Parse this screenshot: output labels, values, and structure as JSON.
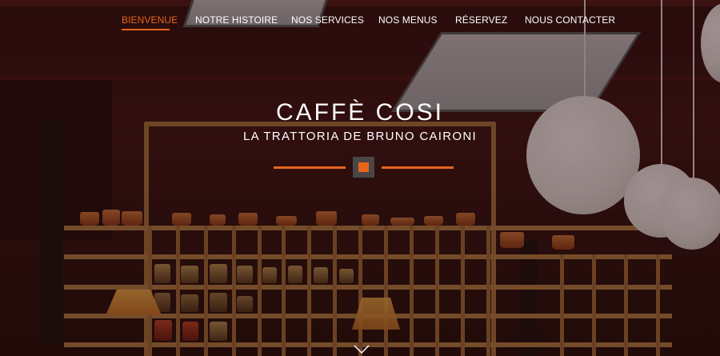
{
  "nav": {
    "items": [
      {
        "label": "BIENVENUE",
        "active": true
      },
      {
        "label": "NOTRE HISTOIRE",
        "active": false
      },
      {
        "label": "NOS SERVICES",
        "active": false
      },
      {
        "label": "NOS MENUS",
        "active": false
      },
      {
        "label": "RÉSERVEZ",
        "active": false
      },
      {
        "label": "NOUS CONTACTER",
        "active": false
      }
    ]
  },
  "hero": {
    "title": "CAFFÈ COSI",
    "subtitle": "LA TRATTORIA DE BRUNO CAIRONI"
  },
  "colors": {
    "accent": "#e8641a",
    "text": "#ffffff",
    "divider_box": "#4a4646"
  },
  "icons": {
    "scroll": "chevron-down-icon"
  }
}
